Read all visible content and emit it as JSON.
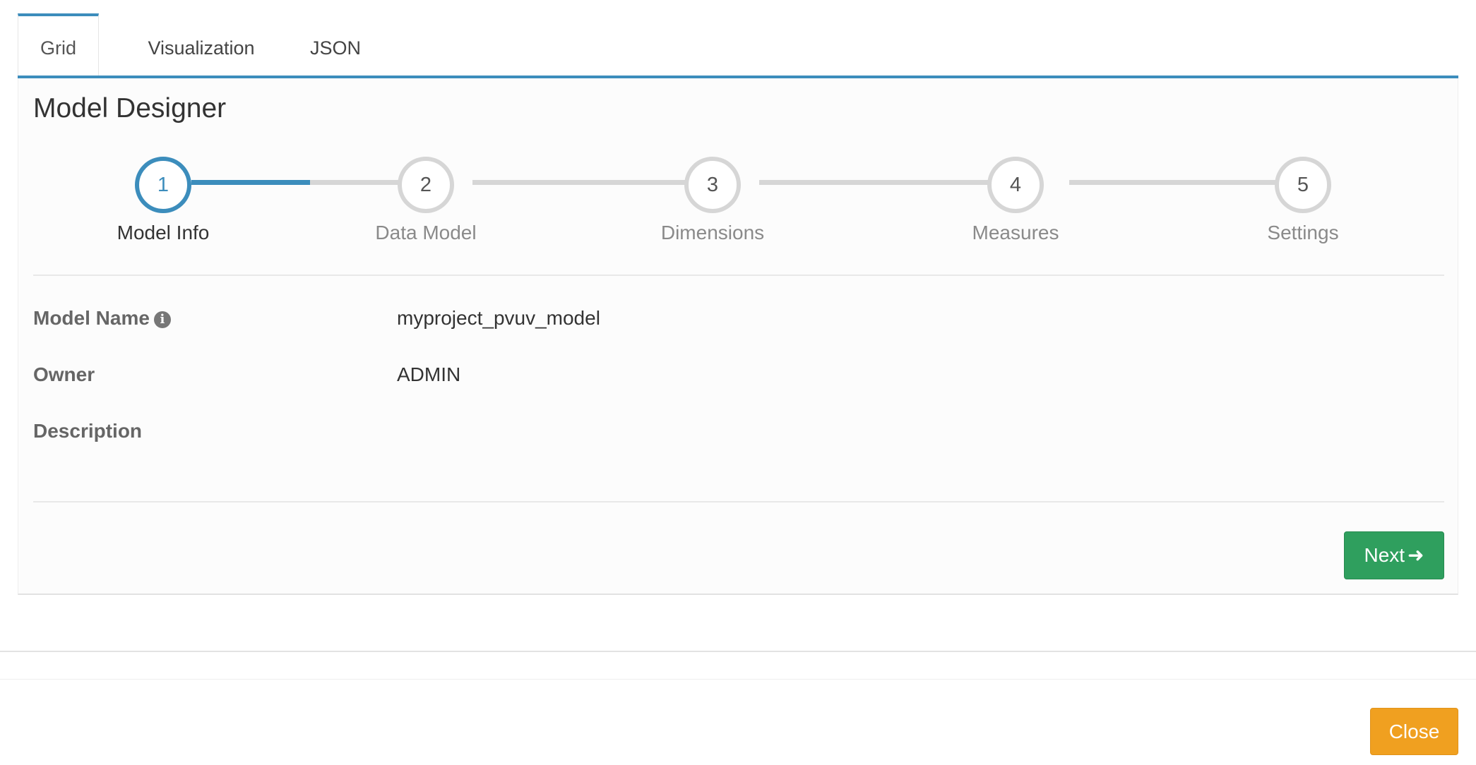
{
  "tabs": [
    {
      "label": "Grid",
      "active": true
    },
    {
      "label": "Visualization",
      "active": false
    },
    {
      "label": "JSON",
      "active": false
    }
  ],
  "panel": {
    "title": "Model Designer"
  },
  "wizard": {
    "steps": [
      {
        "number": "1",
        "label": "Model Info",
        "active": true
      },
      {
        "number": "2",
        "label": "Data Model",
        "active": false
      },
      {
        "number": "3",
        "label": "Dimensions",
        "active": false
      },
      {
        "number": "4",
        "label": "Measures",
        "active": false
      },
      {
        "number": "5",
        "label": "Settings",
        "active": false
      }
    ]
  },
  "form": {
    "model_name": {
      "label": "Model Name",
      "value": "myproject_pvuv_model",
      "info_icon": "info-circle-icon"
    },
    "owner": {
      "label": "Owner",
      "value": "ADMIN"
    },
    "description": {
      "label": "Description",
      "value": ""
    }
  },
  "buttons": {
    "next_label": "Next",
    "next_icon": "arrow-right-icon",
    "close_label": "Close"
  },
  "colors": {
    "accent": "#3c8dbc",
    "next_button": "#2f9f5e",
    "close_button": "#f0a020",
    "inactive_step": "#d6d6d6"
  }
}
